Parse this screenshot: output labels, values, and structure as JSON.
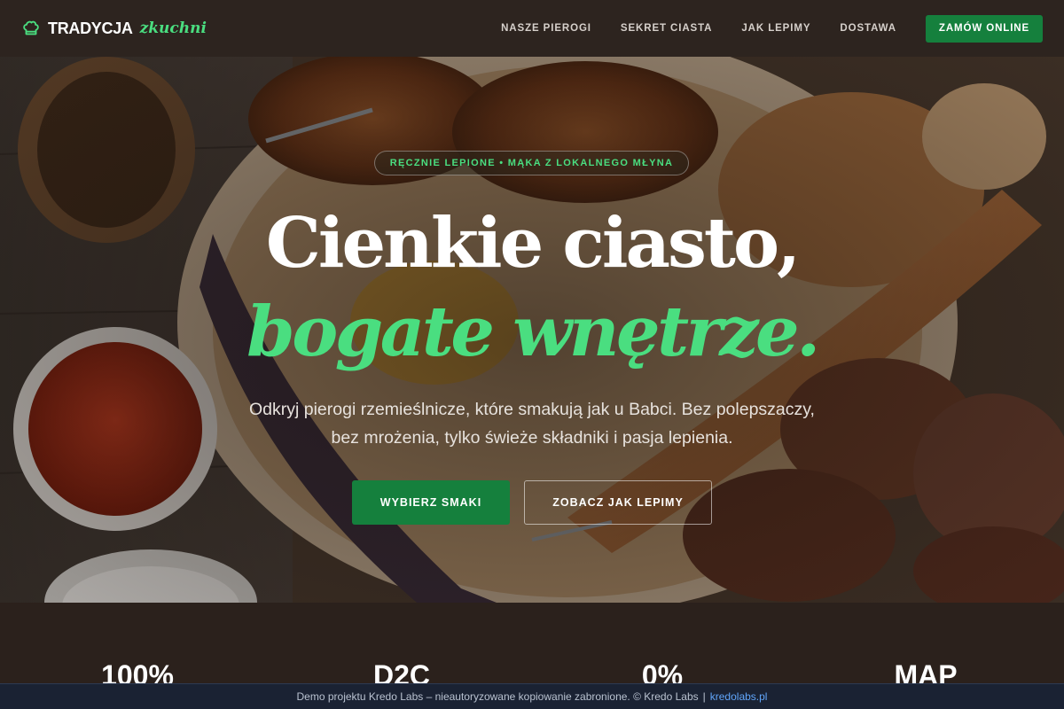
{
  "brand": {
    "name": "TRADYCJA",
    "accent": "zkuchni",
    "icon": "chef-hat-icon"
  },
  "nav": {
    "links": [
      "NASZE PIEROGI",
      "SEKRET CIASTA",
      "JAK LEPIMY",
      "DOSTAWA"
    ],
    "cta": "ZAMÓW ONLINE"
  },
  "hero": {
    "badge": "RĘCZNIE LEPIONE • MĄKA Z LOKALNEGO MŁYNA",
    "headline_line1": "Cienkie ciasto,",
    "headline_line2": "bogate wnętrze.",
    "subtitle": "Odkryj pierogi rzemieślnicze, które smakują jak u Babci. Bez polepszaczy, bez mrożenia, tylko świeże składniki i pasja lepienia.",
    "primary_button": "WYBIERZ SMAKI",
    "secondary_button": "ZOBACZ JAK LEPIMY"
  },
  "stats": [
    "100%",
    "D2C",
    "0%",
    "MAP"
  ],
  "footer": {
    "text": "Demo projektu Kredo Labs – nieautoryzowane kopiowanie zabronione. © Kredo Labs",
    "separator": "|",
    "link": "kredolabs.pl"
  },
  "colors": {
    "accent_green": "#4ade80",
    "button_green": "#15803d",
    "background": "#2b211c",
    "demo_bar": "#1a2233",
    "link_blue": "#60a5fa"
  }
}
